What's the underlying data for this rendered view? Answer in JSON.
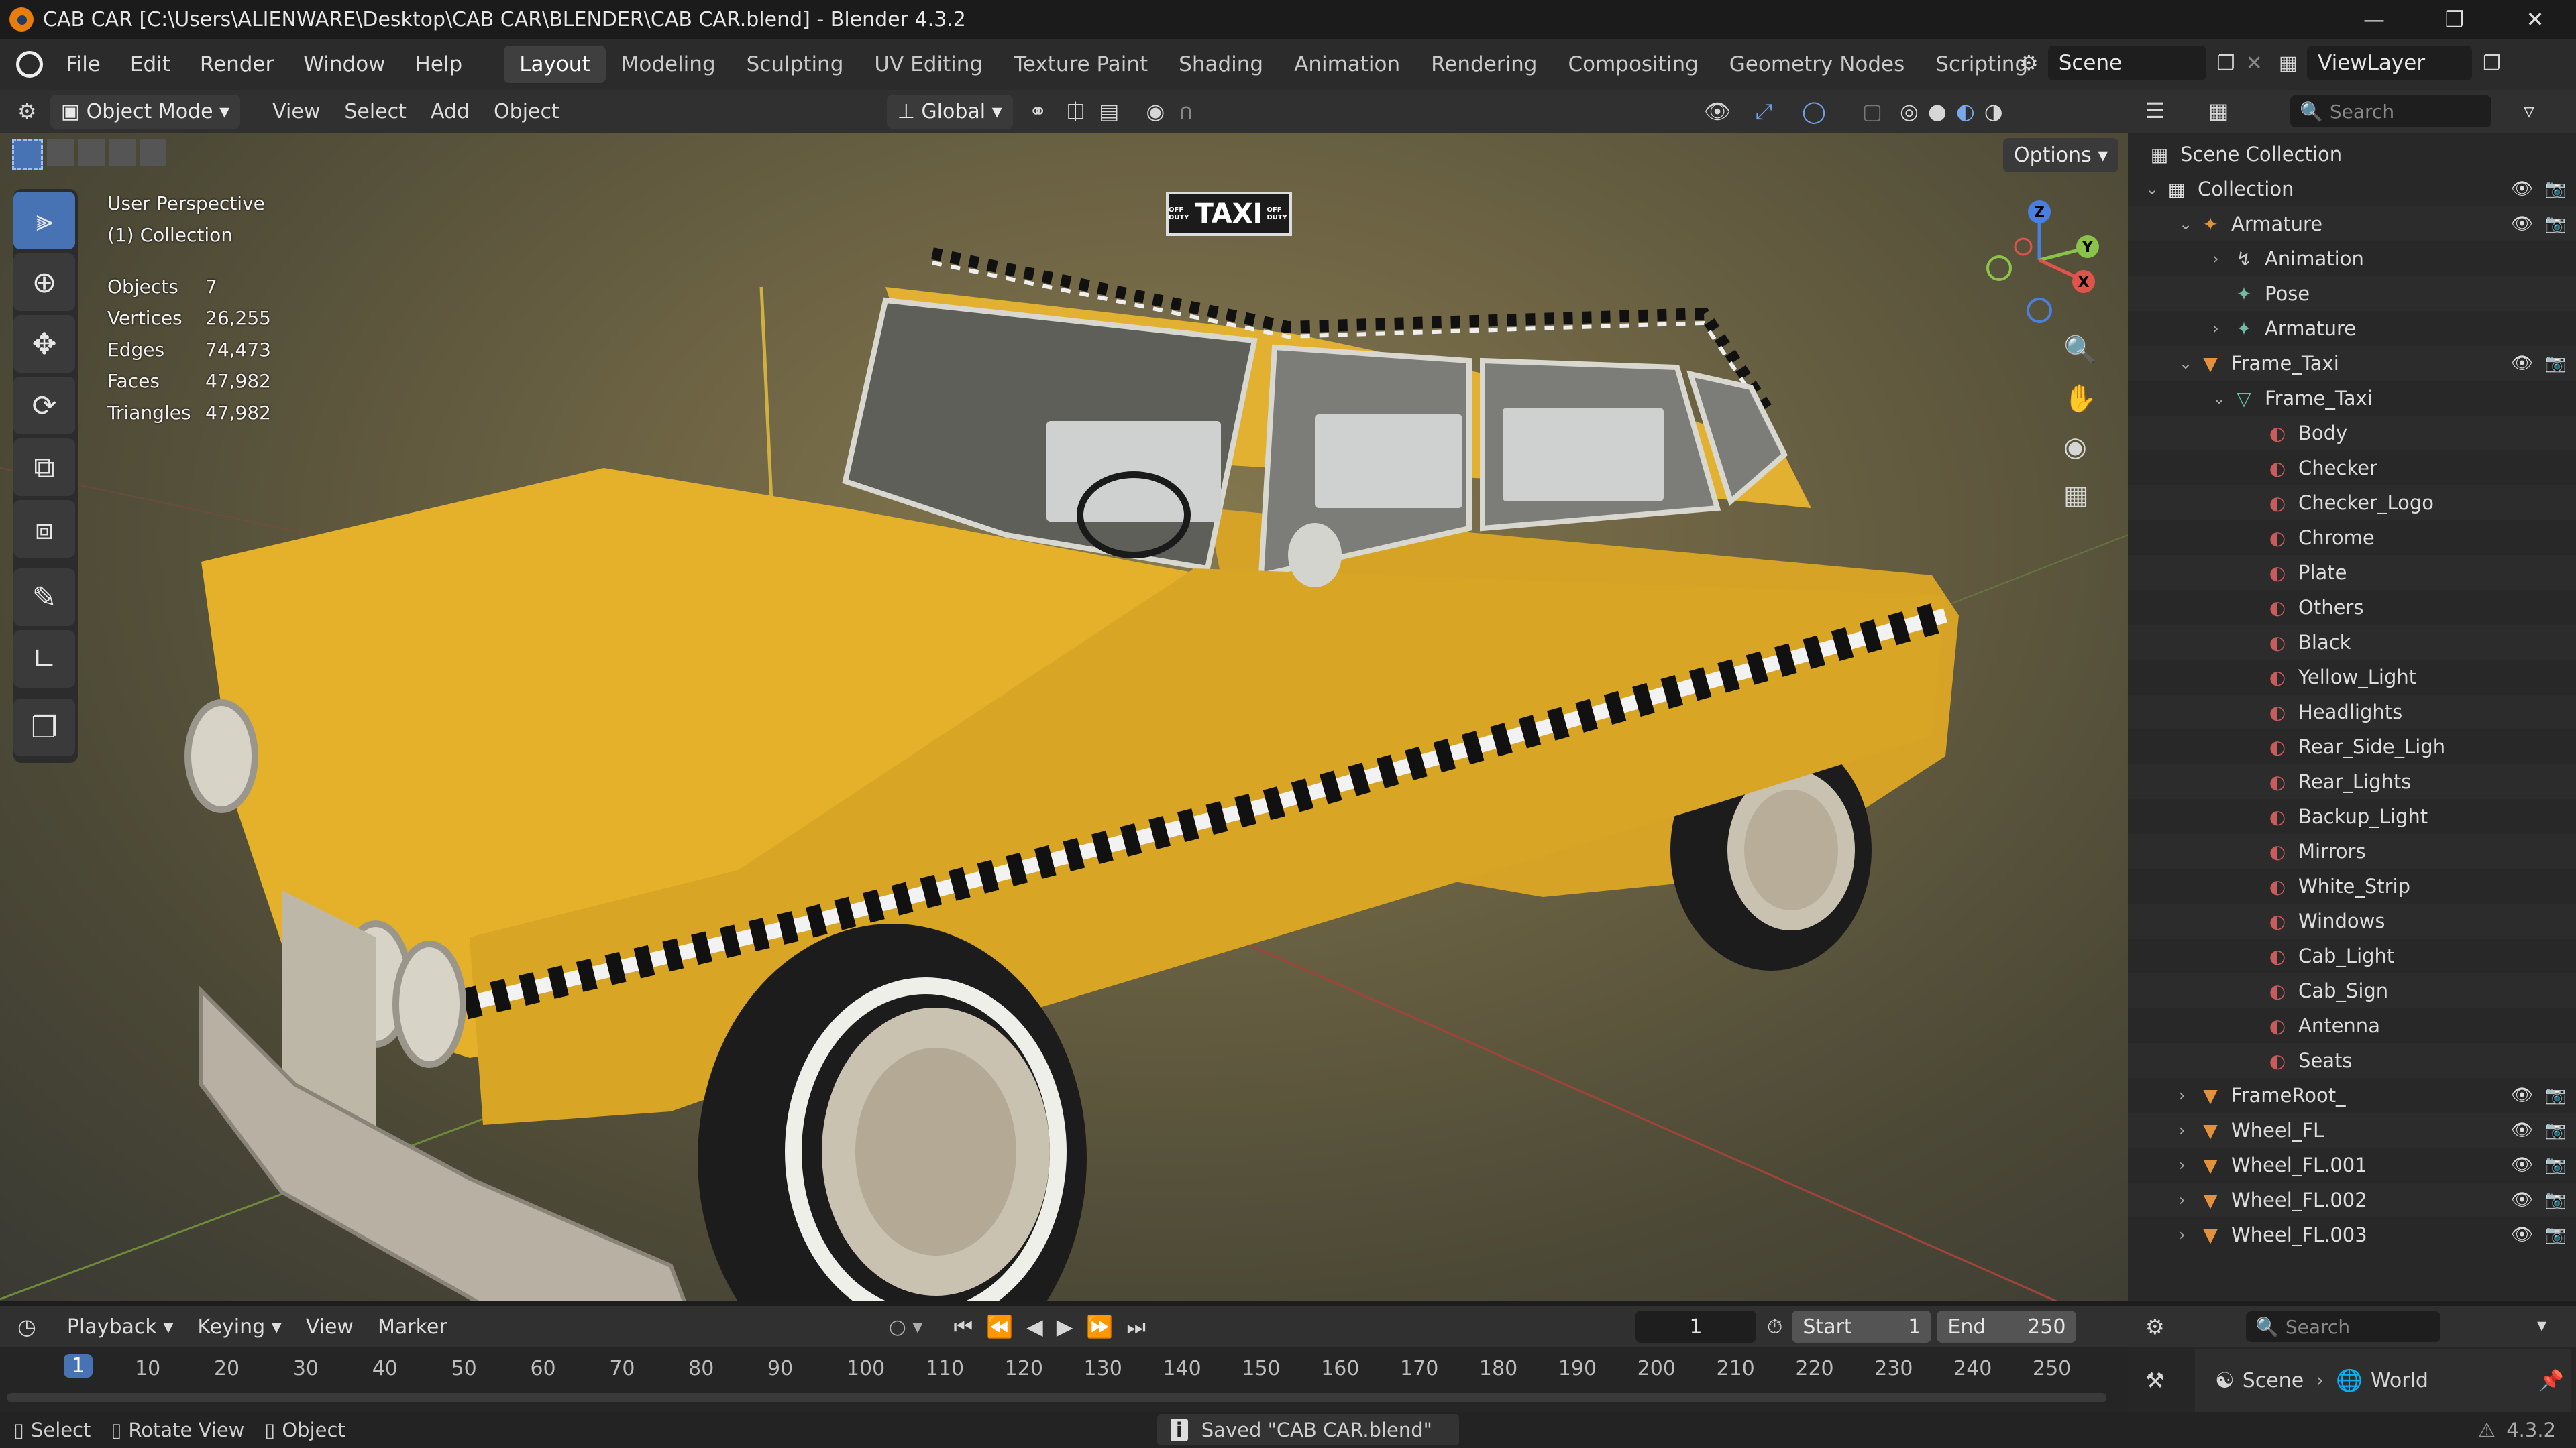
{
  "window": {
    "title": "CAB CAR [C:\\Users\\ALIENWARE\\Desktop\\CAB CAR\\BLENDER\\CAB CAR.blend] - Blender 4.3.2"
  },
  "menu": {
    "items": [
      "File",
      "Edit",
      "Render",
      "Window",
      "Help"
    ]
  },
  "workspaces": [
    "Layout",
    "Modeling",
    "Sculpting",
    "UV Editing",
    "Texture Paint",
    "Shading",
    "Animation",
    "Rendering",
    "Compositing",
    "Geometry Nodes",
    "Scripting"
  ],
  "active_workspace": "Layout",
  "scene_field": "Scene",
  "viewlayer_field": "ViewLayer",
  "viewport_header": {
    "mode": "Object Mode",
    "menus": [
      "View",
      "Select",
      "Add",
      "Object"
    ],
    "orientation": "Global",
    "options_label": "Options"
  },
  "viewport": {
    "perspective": "User Perspective",
    "collection": "(1) Collection",
    "stats": [
      {
        "k": "Objects",
        "v": "7"
      },
      {
        "k": "Vertices",
        "v": "26,255"
      },
      {
        "k": "Edges",
        "v": "74,473"
      },
      {
        "k": "Faces",
        "v": "47,982"
      },
      {
        "k": "Triangles",
        "v": "47,982"
      }
    ],
    "taxi_sign": "TAXI",
    "taxi_sign_small": "OFF DUTY"
  },
  "outliner": {
    "search_placeholder": "Search",
    "root": "Scene Collection",
    "rows": [
      {
        "label": "Collection",
        "type": "collection",
        "depth": 0,
        "expanded": true,
        "vis": true
      },
      {
        "label": "Armature",
        "type": "armature",
        "depth": 1,
        "expanded": true,
        "vis": true
      },
      {
        "label": "Animation",
        "type": "anim",
        "depth": 2,
        "expanded": false,
        "vis": false
      },
      {
        "label": "Pose",
        "type": "pose",
        "depth": 2,
        "expanded": null,
        "vis": false
      },
      {
        "label": "Armature",
        "type": "armdata",
        "depth": 2,
        "expanded": false,
        "vis": false
      },
      {
        "label": "Frame_Taxi",
        "type": "mesh",
        "depth": 1,
        "expanded": true,
        "vis": true
      },
      {
        "label": "Frame_Taxi",
        "type": "meshdata",
        "depth": 2,
        "expanded": true,
        "vis": false
      },
      {
        "label": "Body",
        "type": "material",
        "depth": 3,
        "vis": false
      },
      {
        "label": "Checker",
        "type": "material",
        "depth": 3,
        "vis": false
      },
      {
        "label": "Checker_Logo",
        "type": "material",
        "depth": 3,
        "vis": false
      },
      {
        "label": "Chrome",
        "type": "material",
        "depth": 3,
        "vis": false
      },
      {
        "label": "Plate",
        "type": "material",
        "depth": 3,
        "vis": false
      },
      {
        "label": "Others",
        "type": "material",
        "depth": 3,
        "vis": false
      },
      {
        "label": "Black",
        "type": "material",
        "depth": 3,
        "vis": false
      },
      {
        "label": "Yellow_Light",
        "type": "material",
        "depth": 3,
        "vis": false
      },
      {
        "label": "Headlights",
        "type": "material",
        "depth": 3,
        "vis": false
      },
      {
        "label": "Rear_Side_Ligh",
        "type": "material",
        "depth": 3,
        "vis": false
      },
      {
        "label": "Rear_Lights",
        "type": "material",
        "depth": 3,
        "vis": false
      },
      {
        "label": "Backup_Light",
        "type": "material",
        "depth": 3,
        "vis": false
      },
      {
        "label": "Mirrors",
        "type": "material",
        "depth": 3,
        "vis": false
      },
      {
        "label": "White_Strip",
        "type": "material",
        "depth": 3,
        "vis": false
      },
      {
        "label": "Windows",
        "type": "material",
        "depth": 3,
        "vis": false
      },
      {
        "label": "Cab_Light",
        "type": "material",
        "depth": 3,
        "vis": false
      },
      {
        "label": "Cab_Sign",
        "type": "material",
        "depth": 3,
        "vis": false
      },
      {
        "label": "Antenna",
        "type": "material",
        "depth": 3,
        "vis": false
      },
      {
        "label": "Seats",
        "type": "material",
        "depth": 3,
        "vis": false
      },
      {
        "label": "FrameRoot_",
        "type": "mesh",
        "depth": 1,
        "expanded": false,
        "vis": true
      },
      {
        "label": "Wheel_FL",
        "type": "mesh",
        "depth": 1,
        "expanded": false,
        "vis": true
      },
      {
        "label": "Wheel_FL.001",
        "type": "mesh",
        "depth": 1,
        "expanded": false,
        "vis": true
      },
      {
        "label": "Wheel_FL.002",
        "type": "mesh",
        "depth": 1,
        "expanded": false,
        "vis": true
      },
      {
        "label": "Wheel_FL.003",
        "type": "mesh",
        "depth": 1,
        "expanded": false,
        "vis": true
      }
    ]
  },
  "timeline": {
    "menus": [
      "Playback",
      "Keying",
      "View",
      "Marker"
    ],
    "current_frame": "1",
    "start_label": "Start",
    "start": "1",
    "end_label": "End",
    "end": "250",
    "ticks": [
      "1",
      "10",
      "20",
      "30",
      "40",
      "50",
      "60",
      "70",
      "80",
      "90",
      "100",
      "110",
      "120",
      "130",
      "140",
      "150",
      "160",
      "170",
      "180",
      "190",
      "200",
      "210",
      "220",
      "230",
      "240",
      "250"
    ]
  },
  "properties": {
    "search_placeholder": "Search",
    "scene": "Scene",
    "world": "World"
  },
  "statusbar": {
    "select": "Select",
    "rotate": "Rotate View",
    "object": "Object",
    "message": "Saved \"CAB CAR.blend\"",
    "version": "4.3.2"
  },
  "colors": {
    "accent": "#4772b3",
    "taxi_yellow": "#e9b52a",
    "mesh_orange": "#e3913a",
    "material_red": "#c85b5b"
  }
}
